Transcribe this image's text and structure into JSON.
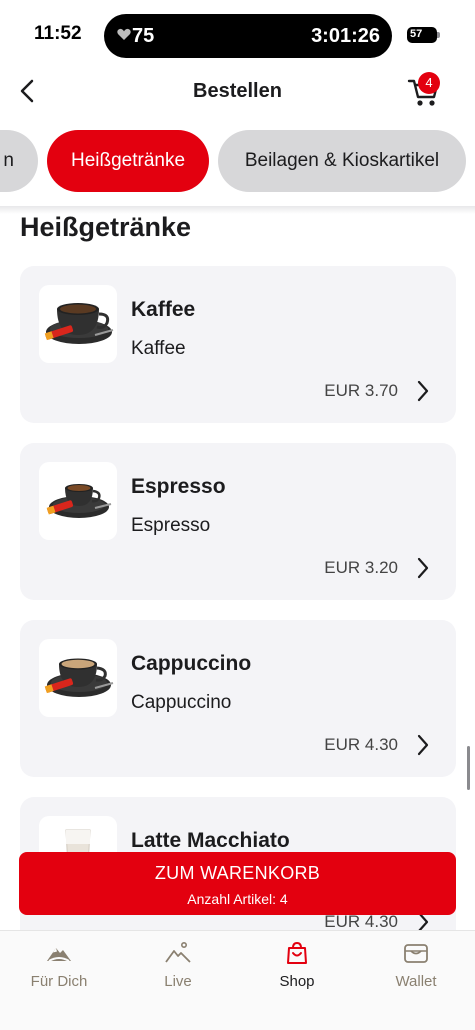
{
  "status_bar": {
    "time": "11:52",
    "heart_rate": "75",
    "timer": "3:01:26",
    "battery": "57"
  },
  "header": {
    "title": "Bestellen",
    "cart_count": "4"
  },
  "category_tabs": [
    {
      "label": "n",
      "active": false
    },
    {
      "label": "Heißgetränke",
      "active": true
    },
    {
      "label": "Beilagen & Kioskartikel",
      "active": false
    }
  ],
  "section_title": "Heißgetränke",
  "products": [
    {
      "name": "Kaffee",
      "description": "Kaffee",
      "price": "EUR 3.70",
      "icon": "coffee-cup-image"
    },
    {
      "name": "Espresso",
      "description": "Espresso",
      "price": "EUR 3.20",
      "icon": "espresso-cup-image"
    },
    {
      "name": "Cappuccino",
      "description": "Cappuccino",
      "price": "EUR 4.30",
      "icon": "cappuccino-cup-image"
    },
    {
      "name": "Latte Macchiato",
      "description": "",
      "price": "EUR 4.30",
      "icon": "latte-glass-image"
    }
  ],
  "cart_cta": {
    "title": "ZUM WARENKORB",
    "subtitle": "Anzahl Artikel: 4"
  },
  "tabbar": [
    {
      "label": "Für Dich",
      "icon": "mountain-icon",
      "active": false
    },
    {
      "label": "Live",
      "icon": "live-mountain-icon",
      "active": false
    },
    {
      "label": "Shop",
      "icon": "shopping-bag-icon",
      "active": true
    },
    {
      "label": "Wallet",
      "icon": "wallet-icon",
      "active": false
    }
  ],
  "colors": {
    "accent": "#e3000f",
    "card_bg": "#f4f4f7",
    "tab_inactive": "#d7d7d9"
  }
}
